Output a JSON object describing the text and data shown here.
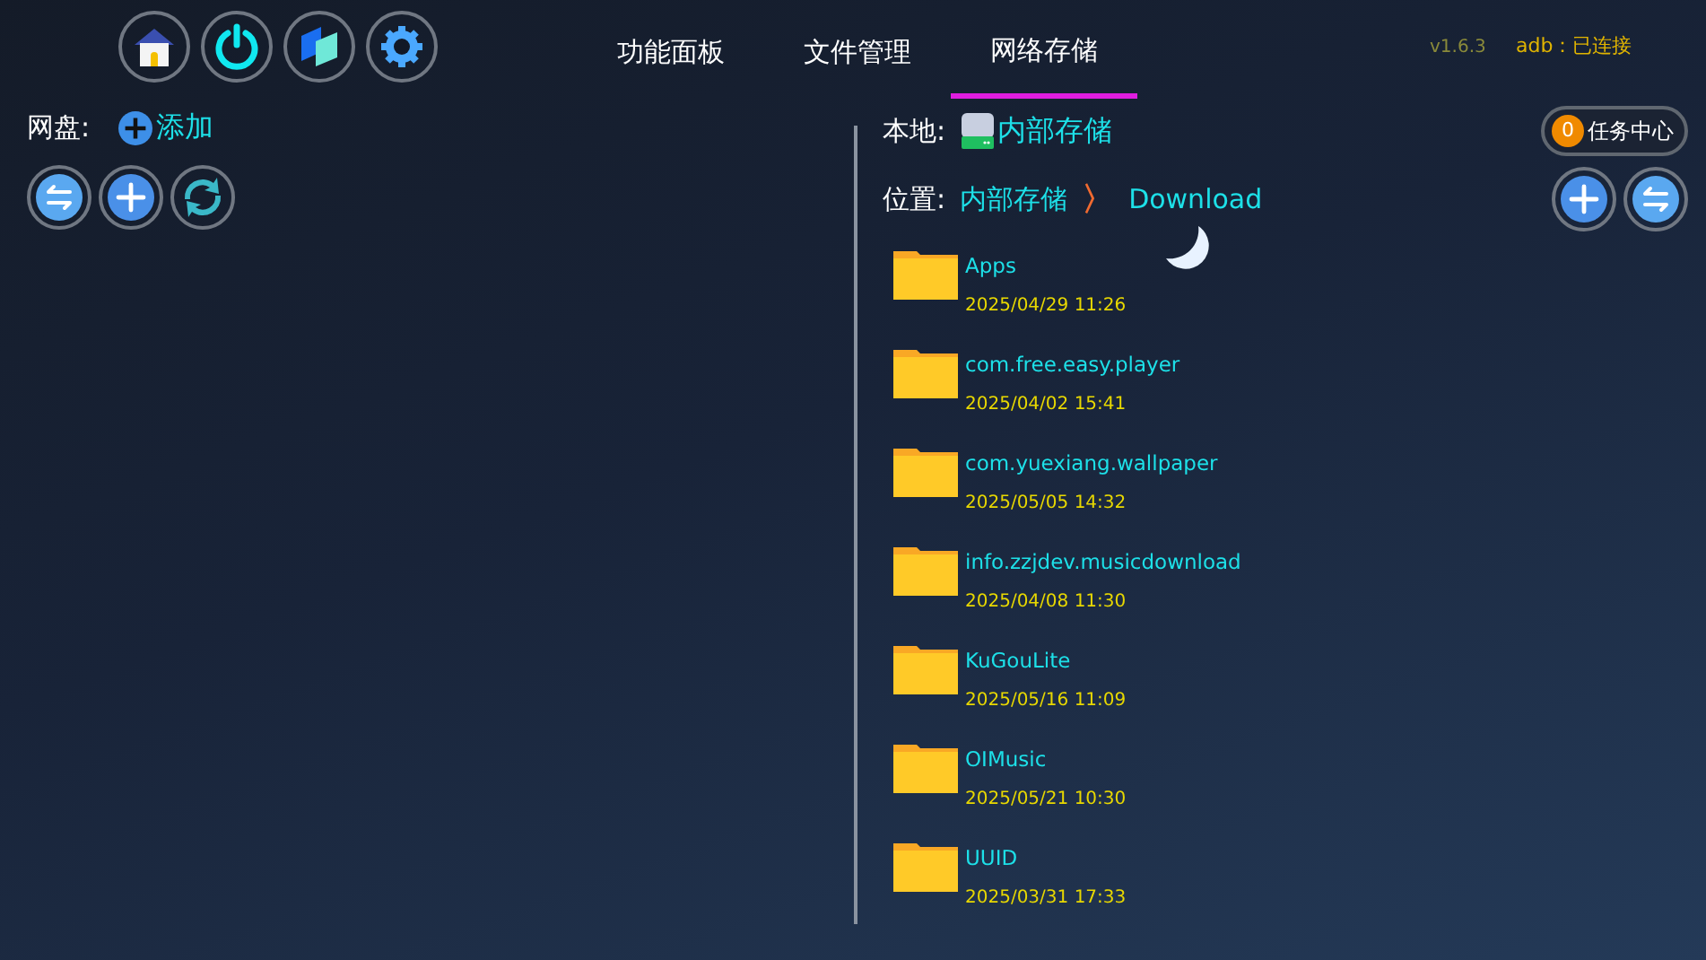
{
  "toolbar": {
    "icons": [
      {
        "kind": "home"
      },
      {
        "kind": "power"
      },
      {
        "kind": "panels"
      },
      {
        "kind": "settings"
      }
    ]
  },
  "tabs": [
    {
      "label": "功能面板",
      "selected": false
    },
    {
      "label": "文件管理",
      "selected": false
    },
    {
      "label": "网络存储",
      "selected": true
    }
  ],
  "version": "v1.6.3",
  "adb_status": "adb：已连接",
  "cloud_pane": {
    "label": "网盘:",
    "add_button": "添加",
    "actions": [
      {
        "kind": "switch"
      },
      {
        "kind": "add"
      },
      {
        "kind": "sync"
      }
    ]
  },
  "local_pane": {
    "label": "本地:",
    "storage": "内部存储",
    "task_center": {
      "count": "0",
      "label": "任务中心"
    },
    "path_label": "位置:",
    "path": [
      "内部存储",
      "Download"
    ],
    "path_separator": "〉",
    "actions": [
      {
        "kind": "add"
      },
      {
        "kind": "switch"
      }
    ],
    "files": [
      {
        "name": "Apps",
        "date": "2025/04/29 11:26"
      },
      {
        "name": "com.free.easy.player",
        "date": "2025/04/02 15:41"
      },
      {
        "name": "com.yuexiang.wallpaper",
        "date": "2025/05/05 14:32"
      },
      {
        "name": "info.zzjdev.musicdownload",
        "date": "2025/04/08 11:30"
      },
      {
        "name": "KuGouLite",
        "date": "2025/05/16 11:09"
      },
      {
        "name": "OIMusic",
        "date": "2025/05/21 10:30"
      },
      {
        "name": "UUID",
        "date": "2025/03/31 17:33"
      }
    ]
  }
}
